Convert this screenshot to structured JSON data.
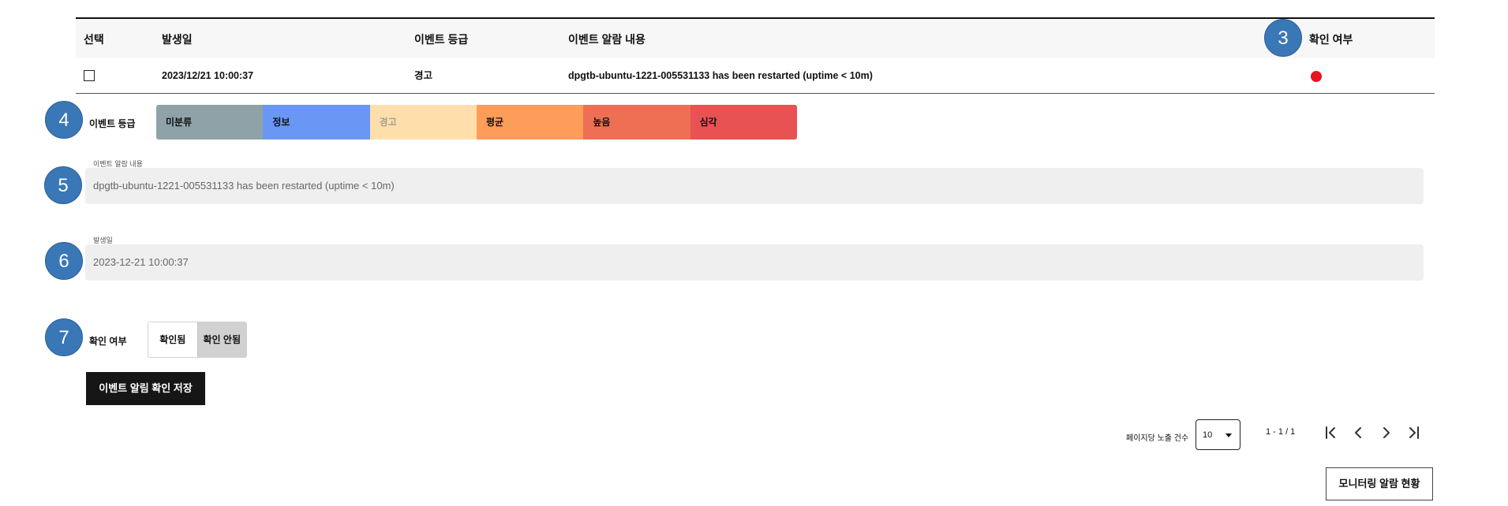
{
  "table": {
    "headers": {
      "select": "선택",
      "date": "발생일",
      "grade": "이벤트 등급",
      "content": "이벤트 알람 내용",
      "confirm": "확인 여부"
    },
    "rows": [
      {
        "date": "2023/12/21 10:00:37",
        "grade": "경고",
        "content": "dpgtb-ubuntu-1221-005531133 has been restarted (uptime < 10m)",
        "confirm_color": "#e8141e"
      }
    ]
  },
  "badges": {
    "b3": "3",
    "b4": "4",
    "b5": "5",
    "b6": "6",
    "b7": "7"
  },
  "form": {
    "grade_label": "이벤트 등급",
    "grades": [
      {
        "label": "미분류",
        "color": "#8ea2a8"
      },
      {
        "label": "정보",
        "color": "#6a97f6"
      },
      {
        "label": "경고",
        "color": "#fedfac"
      },
      {
        "label": "평균",
        "color": "#fe9c59"
      },
      {
        "label": "높음",
        "color": "#ef6f55"
      },
      {
        "label": "심각",
        "color": "#e85253"
      }
    ],
    "content_caption": "이벤트 알람 내용",
    "content_value": "dpgtb-ubuntu-1221-005531133 has been restarted (uptime < 10m)",
    "date_caption": "발생일",
    "date_value": "2023-12-21 10:00:37",
    "confirm_label": "확인 여부",
    "confirm_options": [
      "확인됨",
      "확인 안됨"
    ],
    "save_button": "이벤트 알림 확인 저장"
  },
  "pagination": {
    "per_page_label": "페이지당 노출 건수",
    "per_page_value": "10",
    "page_info": "1 - 1 / 1"
  },
  "monitor_button": "모니터링 알람 현황"
}
